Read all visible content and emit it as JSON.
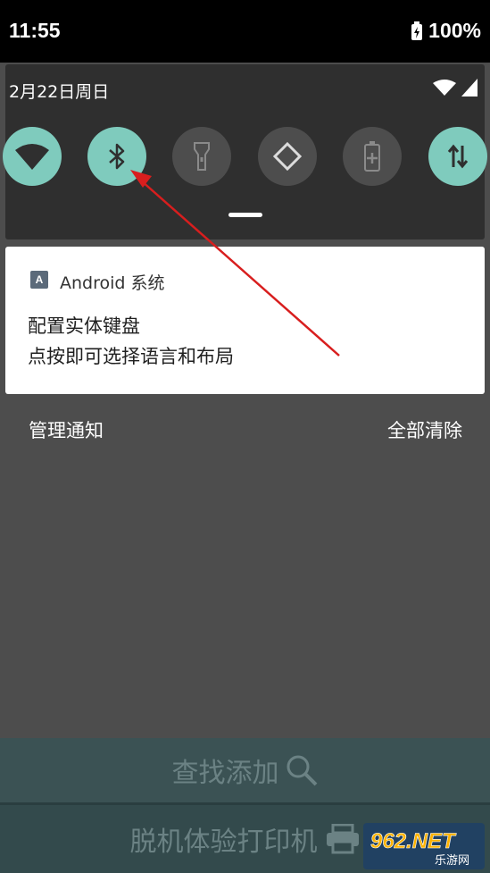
{
  "status_bar": {
    "time": "11:55",
    "battery": "100%"
  },
  "quick_settings": {
    "date": "2月22日周日",
    "tiles": [
      {
        "name": "wifi",
        "icon": "wifi-icon",
        "state": "on"
      },
      {
        "name": "bluetooth",
        "icon": "bluetooth-icon",
        "state": "on"
      },
      {
        "name": "flashlight",
        "icon": "flashlight-icon",
        "state": "off"
      },
      {
        "name": "auto-rotate",
        "icon": "rotate-icon",
        "state": "off"
      },
      {
        "name": "battery-saver",
        "icon": "battery-saver-icon",
        "state": "off"
      },
      {
        "name": "mobile-data",
        "icon": "data-arrows-icon",
        "state": "on"
      }
    ],
    "accent_color": "#7fcbbd"
  },
  "notification": {
    "app_name": "Android 系统",
    "app_icon_letter": "A",
    "title": "配置实体键盘",
    "text": "点按即可选择语言和布局"
  },
  "footer_actions": {
    "manage": "管理通知",
    "clear_all": "全部清除"
  },
  "background_app": {
    "find_add": "查找添加",
    "offline_print": "脱机体验打印机"
  },
  "watermark": {
    "brand": "962.NET",
    "subtitle": "乐游网"
  }
}
